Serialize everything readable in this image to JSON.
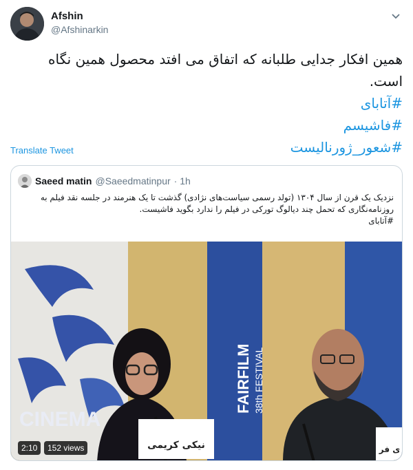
{
  "author": {
    "display_name": "Afshin",
    "handle": "@Afshinarkin",
    "avatar_icon": "profile-photo"
  },
  "tweet": {
    "text": "همین افکار جدایی طلبانه که اتفاق می افتد محصول همین نگاه است.",
    "hashtags": [
      "#آتابای",
      "#فاشیسم",
      "#شعور_ژورنالیست"
    ]
  },
  "translate_label": "Translate Tweet",
  "quoted": {
    "display_name": "Saeed matin",
    "handle": "@Saeedmatinpur",
    "time": "· 1h",
    "text": "نزدیک یک قرن از سال ۱۳۰۴ (تولد رسمی سیاست‌های نژادی) گذشت تا یک هنرمند در جلسه نقد فیلم به روزنامه‌نگاری که تحمل چند دیالوگ تورکی در فیلم را ندارد بگوید فاشیست.",
    "hashtag": "#آتابای",
    "video": {
      "duration": "2:10",
      "views": "152 views",
      "banner_text": "CINEMA",
      "festival_text": "FAIRFILM",
      "festival_sub": "38th FESTIVAL",
      "nameplate_text": "نیکی کریمی",
      "nameplate_text_right": "ی فر"
    }
  },
  "colors": {
    "link": "#1b95e0",
    "secondary_text": "#657786",
    "border": "#ccd6dd"
  }
}
